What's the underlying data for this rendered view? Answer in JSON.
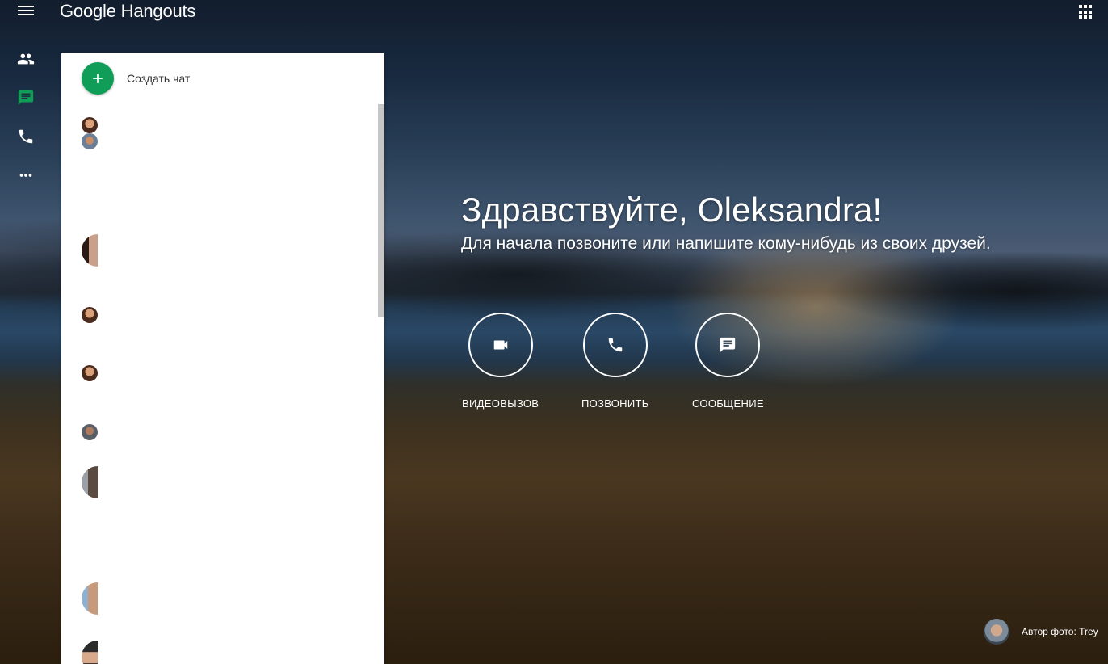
{
  "app": {
    "brand": "Google Hangouts"
  },
  "rail": {
    "items": [
      {
        "name": "contacts",
        "icon": "people-icon",
        "color": "#ffffff"
      },
      {
        "name": "conversations",
        "icon": "chat-icon",
        "color": "#0f9d58"
      },
      {
        "name": "phone",
        "icon": "phone-icon",
        "color": "#ffffff"
      },
      {
        "name": "more",
        "icon": "more-horiz-icon",
        "color": "#ffffff"
      }
    ]
  },
  "panel": {
    "new_chat_label": "Создать чат",
    "conversations_count_visible": 9
  },
  "greeting": {
    "title": "Здравствуйте, Oleksandra!",
    "subtitle": "Для начала позвоните или напишите кому-нибудь из своих друзей."
  },
  "actions": [
    {
      "label": "ВИДЕОВЫЗОВ",
      "icon": "videocam-icon"
    },
    {
      "label": "ПОЗВОНИТЬ",
      "icon": "phone-icon"
    },
    {
      "label": "СООБЩЕНИЕ",
      "icon": "message-icon"
    }
  ],
  "credit": {
    "text": "Автор фото: Trey"
  },
  "colors": {
    "accent": "#0f9d58",
    "panel_bg": "#ffffff"
  }
}
